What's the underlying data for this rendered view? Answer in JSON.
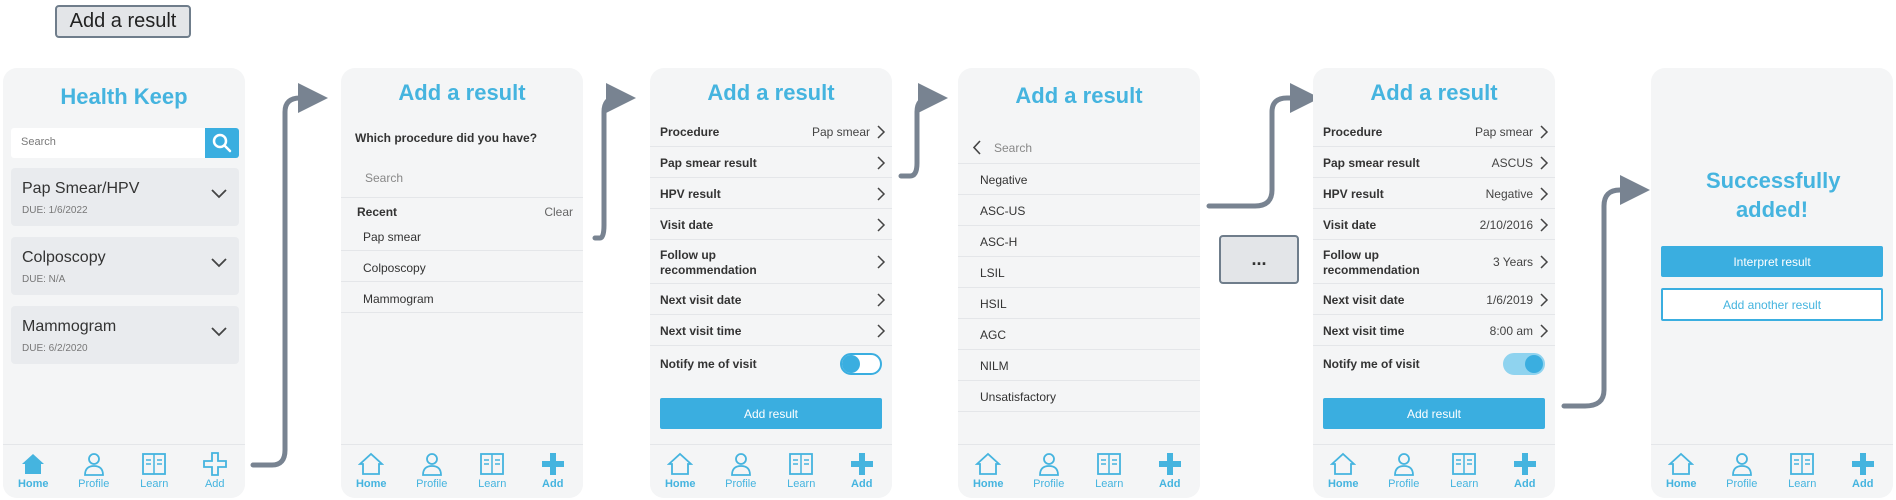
{
  "flow_label": "Add a result",
  "ellipsis": "...",
  "nav": {
    "home": "Home",
    "profile": "Profile",
    "learn": "Learn",
    "add": "Add"
  },
  "colors": {
    "accent": "#45b4df",
    "button": "#3aaee0",
    "connector": "#788391"
  },
  "screen1": {
    "title": "Health Keep",
    "search_placeholder": "Search",
    "cards": [
      {
        "name": "Pap Smear/HPV",
        "due": "DUE: 1/6/2022"
      },
      {
        "name": "Colposcopy",
        "due": "DUE: N/A"
      },
      {
        "name": "Mammogram",
        "due": "DUE: 6/2/2020"
      }
    ]
  },
  "screen2": {
    "title": "Add a result",
    "question": "Which procedure did you have?",
    "search_placeholder": "Search",
    "recent_label": "Recent",
    "clear_label": "Clear",
    "recent_items": [
      "Pap smear",
      "Colposcopy",
      "Mammogram"
    ]
  },
  "screen3": {
    "title": "Add a result",
    "rows": [
      {
        "label": "Procedure",
        "value": "Pap smear"
      },
      {
        "label": "Pap smear result",
        "value": ""
      },
      {
        "label": "HPV result",
        "value": ""
      },
      {
        "label": "Visit date",
        "value": ""
      },
      {
        "label": "Follow up recommendation",
        "value": ""
      },
      {
        "label": "Next visit date",
        "value": ""
      },
      {
        "label": "Next visit time",
        "value": ""
      }
    ],
    "notify_label": "Notify me of visit",
    "notify_on": false,
    "button": "Add result"
  },
  "screen4": {
    "title": "Add a result",
    "search_placeholder": "Search",
    "options": [
      "Negative",
      "ASC-US",
      "ASC-H",
      "LSIL",
      "HSIL",
      "AGC",
      "NILM",
      "Unsatisfactory"
    ]
  },
  "screen5": {
    "title": "Add a result",
    "rows": [
      {
        "label": "Procedure",
        "value": "Pap smear"
      },
      {
        "label": "Pap smear result",
        "value": "ASCUS"
      },
      {
        "label": "HPV result",
        "value": "Negative"
      },
      {
        "label": "Visit date",
        "value": "2/10/2016"
      },
      {
        "label": "Follow up recommendation",
        "value": "3 Years"
      },
      {
        "label": "Next visit date",
        "value": "1/6/2019"
      },
      {
        "label": "Next visit time",
        "value": "8:00 am"
      }
    ],
    "notify_label": "Notify me of visit",
    "notify_on": true,
    "button": "Add result"
  },
  "screen6": {
    "title": "Successfully added!",
    "interpret_button": "Interpret result",
    "add_another_button": "Add another result"
  }
}
